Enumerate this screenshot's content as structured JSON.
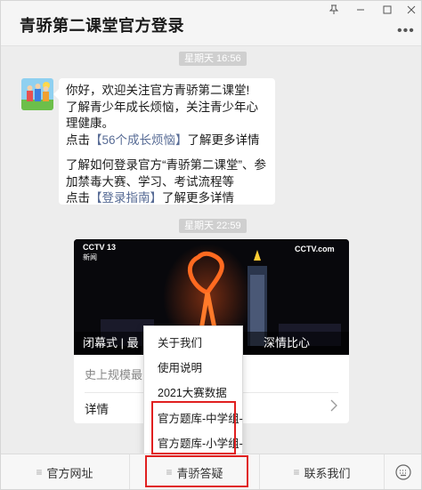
{
  "window": {
    "title": "青骄第二课堂官方登录",
    "more_icon": "more-dots-icon"
  },
  "timestamps": [
    "星期天 16:56",
    "星期天 22:59"
  ],
  "message": {
    "line1": "你好，欢迎关注官方青骄第二课堂!",
    "line2": "了解青少年成长烦恼，关注青少年心理健康。",
    "line3_prefix": "点击",
    "line3_link": "【56个成长烦恼】",
    "line3_suffix": "了解更多详情",
    "line4": "了解如何登录官方“青骄第二课堂”、参加禁毒大赛、学习、考试流程等",
    "line5_prefix": "点击",
    "line5_link": "【登录指南】",
    "line5_suffix": "了解更多详情"
  },
  "article_card": {
    "image_logo_left": "CCTV 13",
    "image_logo_left_sub": "新闻",
    "image_logo_right": "CCTV.com",
    "caption_left": "闭幕式 | 最",
    "caption_right": "深情比心",
    "summary": "史上规模最",
    "detail_label": "详情"
  },
  "popup_menu": {
    "items": [
      "关于我们",
      "使用说明",
      "2021大赛数据",
      "官方题库-中学组-",
      "官方题库-小学组-"
    ]
  },
  "bottom_menu": {
    "tabs": [
      {
        "label": "官方网址"
      },
      {
        "label": "青骄答疑"
      },
      {
        "label": "联系我们"
      }
    ]
  },
  "colors": {
    "link": "#576b95",
    "highlight": "#e02020",
    "background": "#ededed"
  }
}
